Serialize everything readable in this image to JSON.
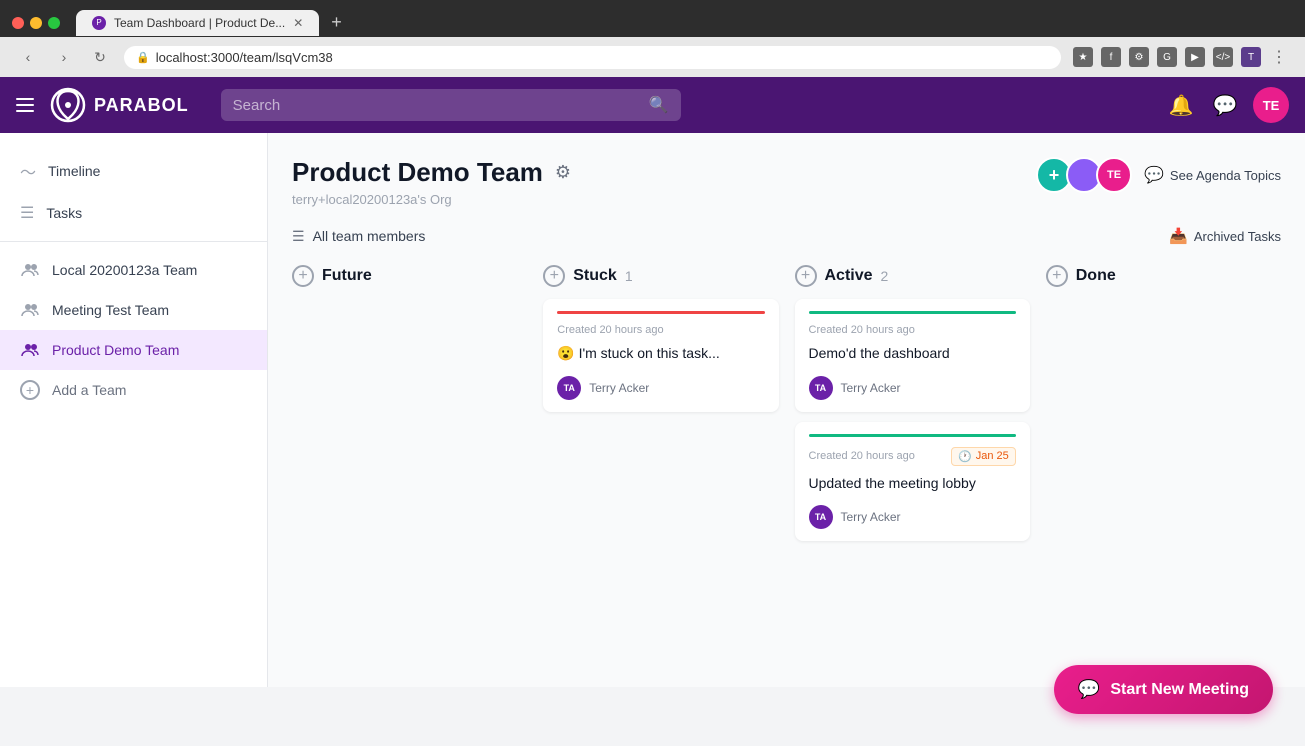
{
  "browser": {
    "tab_title": "Team Dashboard | Product De...",
    "url": "localhost:3000/team/lsqVcm38",
    "new_tab_label": "+"
  },
  "navbar": {
    "logo_text": "PARABOL",
    "search_placeholder": "Search",
    "avatar_initials": "TE"
  },
  "sidebar": {
    "items": [
      {
        "id": "timeline",
        "label": "Timeline",
        "icon": "timeline"
      },
      {
        "id": "tasks",
        "label": "Tasks",
        "icon": "tasks"
      }
    ],
    "teams": [
      {
        "id": "local",
        "label": "Local 20200123a Team"
      },
      {
        "id": "meeting-test",
        "label": "Meeting Test Team"
      },
      {
        "id": "product-demo",
        "label": "Product Demo Team",
        "active": true
      }
    ],
    "add_team_label": "Add a Team"
  },
  "team": {
    "title": "Product Demo Team",
    "org": "terry+local20200123a's Org",
    "see_agenda_label": "See Agenda Topics",
    "avatars": [
      {
        "initials": "",
        "color": "#14b8a6",
        "type": "add"
      },
      {
        "initials": "",
        "color": "#8b5cf6"
      },
      {
        "initials": "TE",
        "color": "#e91e8c"
      }
    ]
  },
  "filters": {
    "all_members_label": "All team members",
    "archived_label": "Archived Tasks"
  },
  "columns": [
    {
      "id": "future",
      "title": "Future",
      "count": null,
      "cards": []
    },
    {
      "id": "stuck",
      "title": "Stuck",
      "count": "1",
      "cards": [
        {
          "indicator": "red",
          "created": "Created 20 hours ago",
          "content": "😮 I'm stuck on this task...",
          "user_name": "Terry Acker",
          "due": null
        }
      ]
    },
    {
      "id": "active",
      "title": "Active",
      "count": "2",
      "cards": [
        {
          "indicator": "green",
          "created": "Created 20 hours ago",
          "content": "Demo'd the dashboard",
          "user_name": "Terry Acker",
          "due": null
        },
        {
          "indicator": "green",
          "created": "Created 20 hours ago",
          "content": "Updated the meeting lobby",
          "user_name": "Terry Acker",
          "due": "Jan 25"
        }
      ]
    },
    {
      "id": "done",
      "title": "Done",
      "count": null,
      "cards": []
    }
  ],
  "start_meeting": {
    "label": "Start New Meeting"
  }
}
